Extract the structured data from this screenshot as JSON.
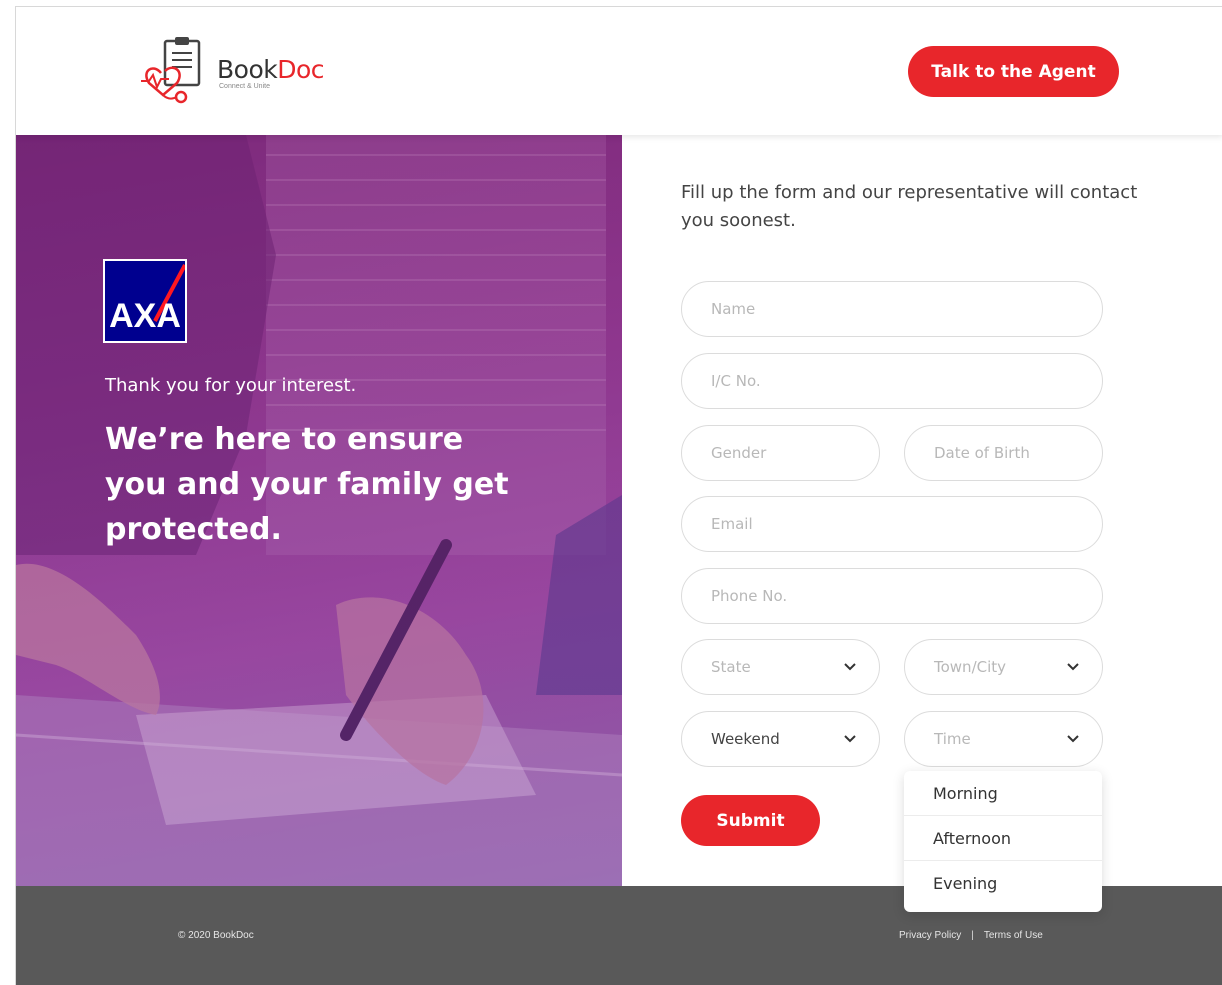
{
  "header": {
    "logo": {
      "book": "Book",
      "doc": "Doc",
      "tagline": "Connect & Unite"
    },
    "agent_button": "Talk to the Agent"
  },
  "hero": {
    "brand_logo": "AXA",
    "thanks": "Thank you for your interest.",
    "headline": "We’re here to ensure you and your family get protected."
  },
  "form": {
    "intro": "Fill up the form and our representative will contact you soonest.",
    "fields": {
      "name": "Name",
      "ic_no": "I/C No.",
      "gender": "Gender",
      "dob": "Date of Birth",
      "email": "Email",
      "phone": "Phone No.",
      "state": "State",
      "town": "Town/City",
      "day": "Weekend",
      "time": "Time"
    },
    "submit": "Submit",
    "time_options": [
      "Morning",
      "Afternoon",
      "Evening"
    ]
  },
  "footer": {
    "copyright": "© 2020 BookDoc",
    "links": [
      "Privacy Policy",
      "Terms of Use"
    ],
    "separator": "|"
  },
  "colors": {
    "accent": "#e8262b",
    "footer": "#595959",
    "axa_blue": "#00008f"
  }
}
